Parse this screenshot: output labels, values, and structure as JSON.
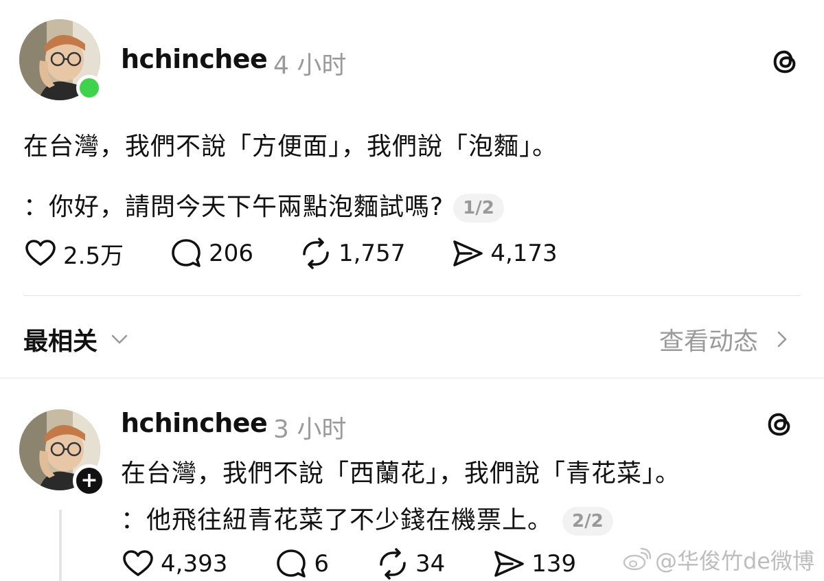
{
  "post1": {
    "username": "hchinchee",
    "time": "4 小时",
    "line1": "在台灣，我們不說「方便面」，我們說「泡麵」。",
    "line2": "：你好，請問今天下午兩點泡麵試嗎?",
    "page": "1/2",
    "likes": "2.5万",
    "replies": "206",
    "reposts": "1,757",
    "shares": "4,173"
  },
  "sort_bar": {
    "label": "最相关",
    "activity": "查看动态"
  },
  "post2": {
    "username": "hchinchee",
    "time": "3 小时",
    "line1": "在台灣，我們不說「西蘭花」，我們說「青花菜」。",
    "line2": "：他飛往紐青花菜了不少錢在機票上。",
    "page": "2/2",
    "likes": "4,393",
    "replies": "6",
    "reposts": "34",
    "shares": "139"
  },
  "watermark": "@华俊竹de微博",
  "icons": {
    "like": "heart-icon",
    "reply": "comment-icon",
    "repost": "repost-icon",
    "share": "share-icon",
    "app": "threads-icon",
    "online": "online-status-dot",
    "follow": "follow-plus-icon"
  },
  "colors": {
    "online": "#3fd24b",
    "muted": "#9a9a9a",
    "text": "#111111"
  }
}
